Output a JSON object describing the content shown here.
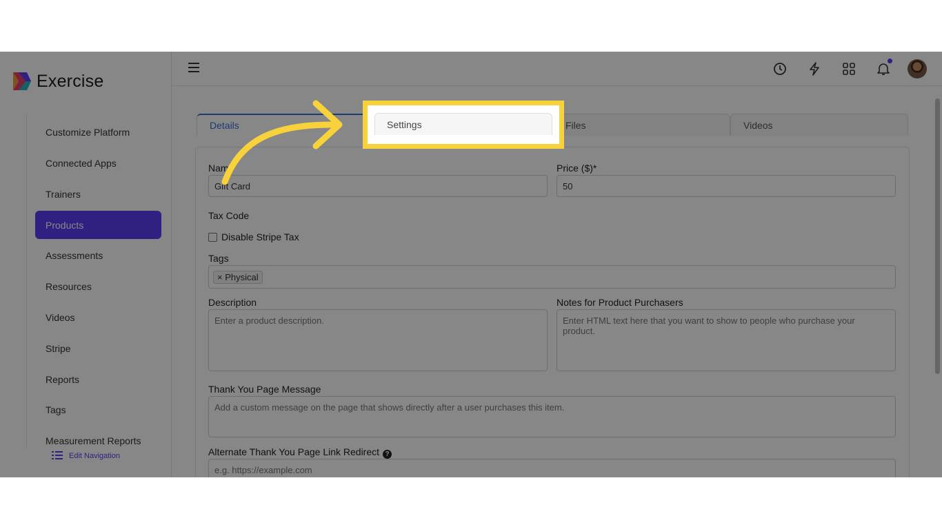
{
  "app": {
    "name": "Exercise"
  },
  "sidebar": {
    "items": [
      {
        "label": "Customize Platform",
        "active": false
      },
      {
        "label": "Connected Apps",
        "active": false
      },
      {
        "label": "Trainers",
        "active": false
      },
      {
        "label": "Products",
        "active": true
      },
      {
        "label": "Assessments",
        "active": false
      },
      {
        "label": "Resources",
        "active": false
      },
      {
        "label": "Videos",
        "active": false
      },
      {
        "label": "Stripe",
        "active": false
      },
      {
        "label": "Reports",
        "active": false
      },
      {
        "label": "Tags",
        "active": false
      },
      {
        "label": "Measurement Reports",
        "active": false
      }
    ],
    "edit_navigation": "Edit Navigation"
  },
  "topbar": {
    "icons": [
      "history-icon",
      "bolt-icon",
      "apps-grid-icon",
      "bell-icon",
      "user-avatar"
    ]
  },
  "tabs": {
    "details": "Details",
    "settings": "Settings",
    "files": "Files",
    "videos": "Videos"
  },
  "form": {
    "name_label": "Name",
    "name_value": "Gift Card",
    "price_label": "Price ($)*",
    "price_value": "50",
    "tax_code_label": "Tax Code",
    "disable_stripe_tax_label": "Disable Stripe Tax",
    "tags_label": "Tags",
    "tags": [
      "× Physical"
    ],
    "description_label": "Description",
    "description_placeholder": "Enter a product description.",
    "notes_label": "Notes for Product Purchasers",
    "notes_placeholder": "Enter HTML text here that you want to show to people who purchase your product.",
    "thank_you_label": "Thank You Page Message",
    "thank_you_placeholder": "Add a custom message on the page that shows directly after a user purchases this item.",
    "redirect_label": "Alternate Thank You Page Link Redirect",
    "redirect_placeholder": "e.g. https://example.com"
  },
  "colors": {
    "accent": "#5b3df5",
    "tab_active": "#3b6fd8",
    "highlight": "#f8d23a"
  }
}
